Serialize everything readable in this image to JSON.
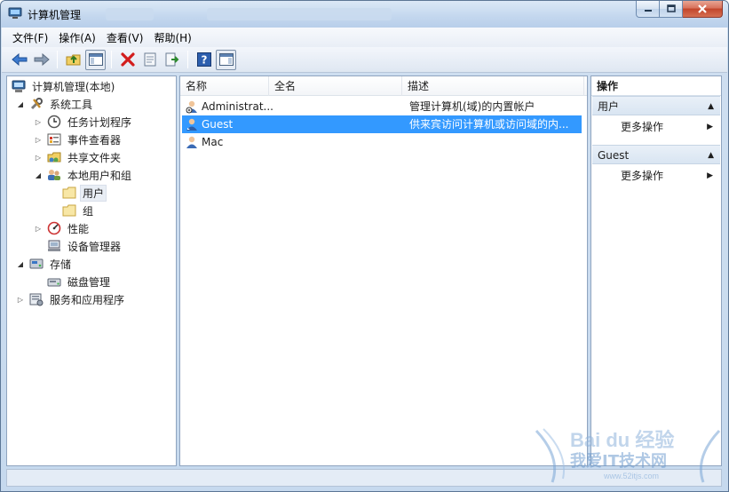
{
  "window": {
    "title": "计算机管理"
  },
  "menu": [
    "文件(F)",
    "操作(A)",
    "查看(V)",
    "帮助(H)"
  ],
  "tree": {
    "root": "计算机管理(本地)",
    "system_tools": "系统工具",
    "task_scheduler": "任务计划程序",
    "event_viewer": "事件查看器",
    "shared_folders": "共享文件夹",
    "local_users_groups": "本地用户和组",
    "users": "用户",
    "groups": "组",
    "performance": "性能",
    "device_manager": "设备管理器",
    "storage": "存储",
    "disk_management": "磁盘管理",
    "services_apps": "服务和应用程序"
  },
  "list": {
    "columns": [
      "名称",
      "全名",
      "描述"
    ],
    "rows": [
      {
        "name": "Administrat...",
        "full": "",
        "desc": "管理计算机(域)的内置帐户"
      },
      {
        "name": "Guest",
        "full": "",
        "desc": "供来宾访问计算机或访问域的内..."
      },
      {
        "name": "Mac",
        "full": "",
        "desc": ""
      }
    ]
  },
  "actions": {
    "header": "操作",
    "group1": "用户",
    "group1_more": "更多操作",
    "group2": "Guest",
    "group2_more": "更多操作"
  },
  "watermark": {
    "brand": "Bai du 经验",
    "site_cn": "我爱IT技术网",
    "site_url": "www.52itjs.com"
  },
  "colors": {
    "selection": "#3399ff",
    "frame": "#c6d9ee"
  }
}
